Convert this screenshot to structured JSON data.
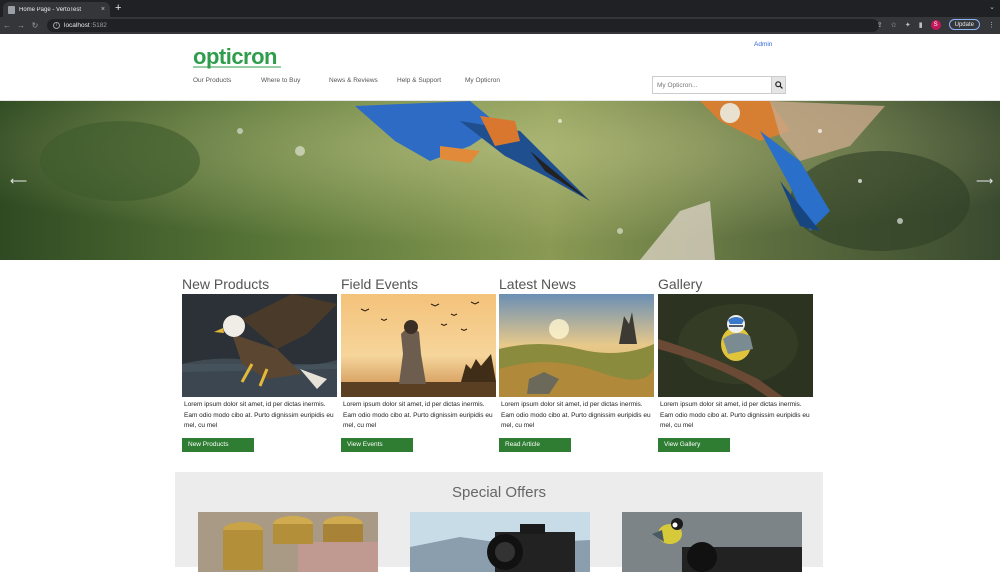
{
  "browser": {
    "tab_title": "Home Page - VertoTest",
    "tab_close": "×",
    "new_tab": "+",
    "url_host": "localhost",
    "url_port": ":5182",
    "profile_initial": "S",
    "update_label": "Update"
  },
  "header": {
    "logo_text": "opticron",
    "admin_link": "Admin",
    "nav": [
      "Our Products",
      "Where to Buy",
      "News & Reviews",
      "Help & Support",
      "My Opticron"
    ],
    "search_placeholder": "My Opticron..."
  },
  "hero": {
    "prev_arrow": "⟵",
    "next_arrow": "⟶"
  },
  "sections": [
    {
      "title": "New Products",
      "text": "Lorem ipsum dolor sit amet, id per dictas inermis. Eam odio modo cibo at. Purto dignissim euripidis eu mel, cu mel",
      "button": "New Products"
    },
    {
      "title": "Field Events",
      "text": "Lorem ipsum dolor sit amet, id per dictas inermis. Eam odio modo cibo at. Purto dignissim euripidis eu mel, cu mel",
      "button": "View Events"
    },
    {
      "title": "Latest News",
      "text": "Lorem ipsum dolor sit amet, id per dictas inermis. Eam odio modo cibo at. Purto dignissim euripidis eu mel, cu mel",
      "button": "Read Article"
    },
    {
      "title": "Gallery",
      "text": "Lorem ipsum dolor sit amet, id per dictas inermis. Eam odio modo cibo at. Purto dignissim euripidis eu mel, cu mel",
      "button": "View Gallery"
    }
  ],
  "offers": {
    "title": "Special Offers"
  },
  "colors": {
    "brand_green": "#2f9d4c",
    "button_green": "#2e7d32",
    "admin_blue": "#3367d6"
  }
}
